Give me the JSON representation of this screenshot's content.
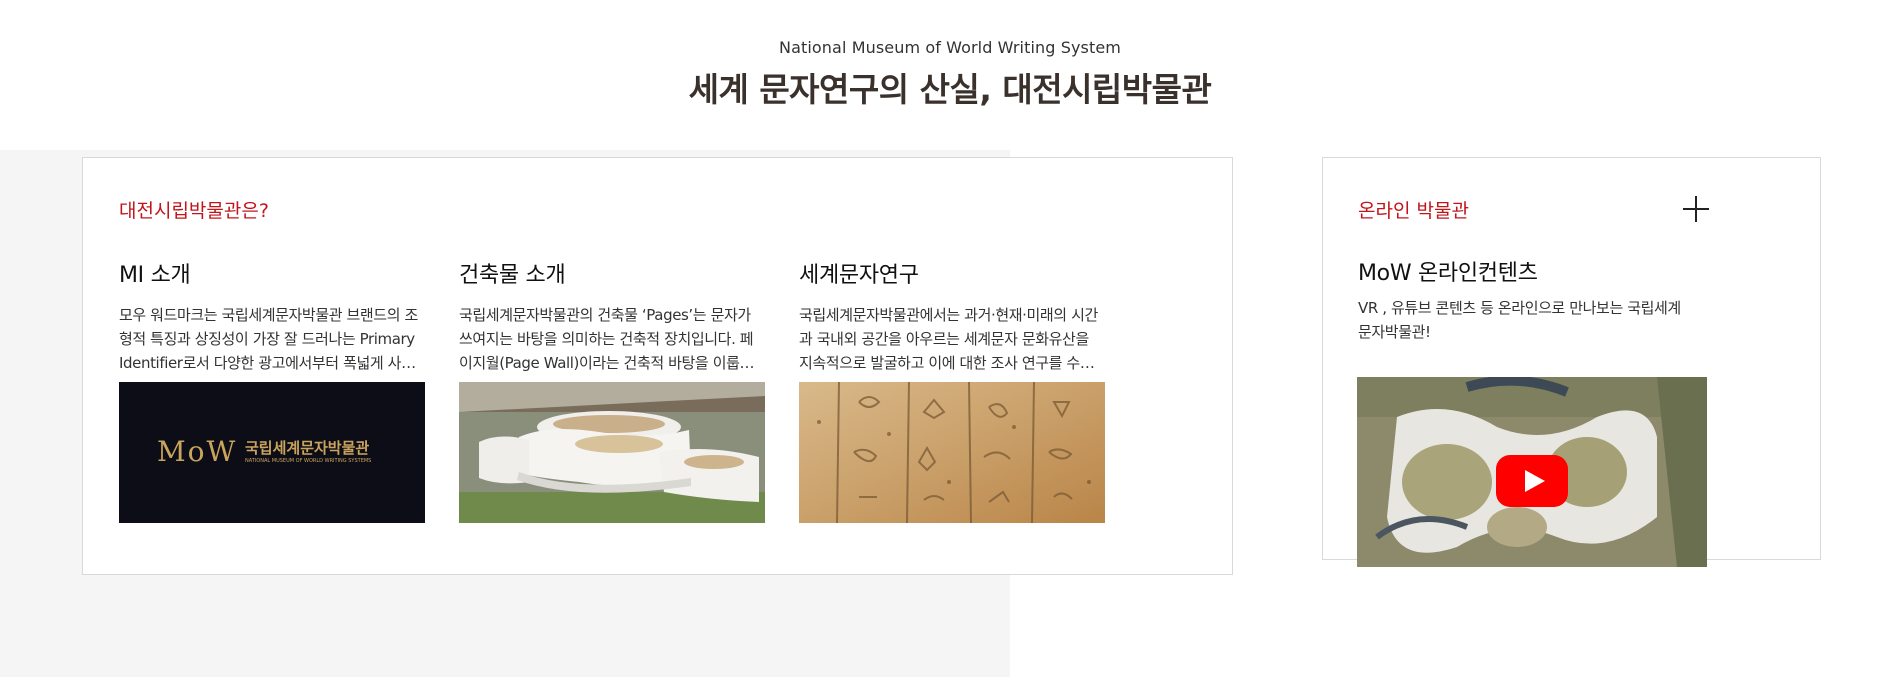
{
  "header": {
    "subtitle": "National Museum of World Writing System",
    "title": "세계 문자연구의 산실, 대전시립박물관"
  },
  "about": {
    "label": "대전시립박물관은?",
    "items": [
      {
        "title": "MI 소개",
        "desc": "모우 워드마크는 국립세계문자박물관 브랜드의 조형적 특징과 상징성이 가장 잘 드러나는 Primary Identifier로서 다양한 광고에서부터 폭넓게 사용됩니다.",
        "logo_mark": "MoW",
        "logo_text": "국립세계문자박물관",
        "logo_sub": "NATIONAL MUSEUM OF WORLD WRITING SYSTEMS"
      },
      {
        "title": "건축물 소개",
        "desc": "국립세계문자박물관의 건축물 ‘Pages’는 문자가 쓰여지는 바탕을 의미하는 건축적 장치입니다. 페이지월(Page Wall)이라는 건축적 바탕을 이룹니다."
      },
      {
        "title": "세계문자연구",
        "desc": "국립세계문자박물관에서는 과거·현재·미래의 시간과 국내외 공간을 아우르는 세계문자 문화유산을 지속적으로 발굴하고 이에 대한 조사 연구를 수행합니다."
      }
    ]
  },
  "online": {
    "label": "온라인 박물관",
    "title": "MoW 온라인컨텐츠",
    "desc": "VR , 유튜브 콘텐츠 등 온라인으로 만나보는 국립세계문자박물관!"
  },
  "colors": {
    "accent": "#c0161b",
    "title": "#3a302c",
    "logo_gold": "#c9a45c",
    "logo_bg": "#0d0d17",
    "play_red": "#ff0000"
  },
  "icons": [
    "plus-icon",
    "youtube-play-icon"
  ]
}
